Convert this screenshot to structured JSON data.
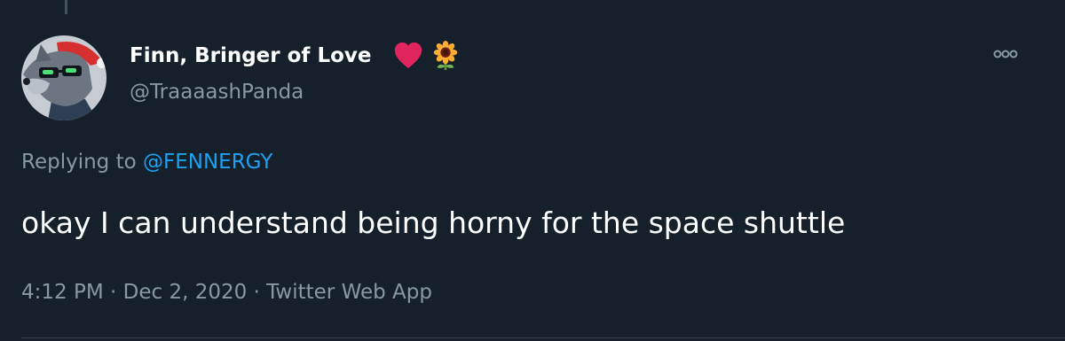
{
  "author": {
    "display_name": "Finn, Bringer of Love",
    "name_emojis": [
      "heart-emoji",
      "sunflower-emoji"
    ],
    "handle": "@TraaaashPanda",
    "avatar_icon": "wolf-avatar"
  },
  "reply": {
    "prefix": "Replying to ",
    "to_handle": "@FENNERGY"
  },
  "tweet": {
    "text": "okay I can understand being horny for the space shuttle"
  },
  "meta": {
    "time": "4:12 PM",
    "date": "Dec 2, 2020",
    "source": "Twitter Web App",
    "separator": " · "
  },
  "colors": {
    "background": "#15202b",
    "primary_text": "#ffffff",
    "secondary_text": "#8899a6",
    "link": "#1da1f2",
    "divider": "#38444d",
    "heart": "#e0245e"
  }
}
